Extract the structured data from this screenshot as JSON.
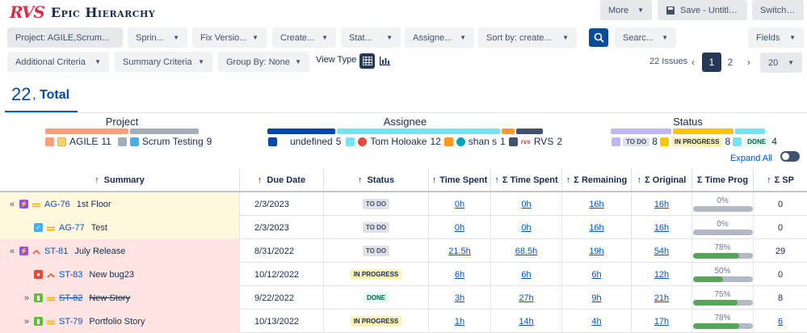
{
  "app": {
    "logo": "RVS",
    "title": "Epic Hierarchy"
  },
  "top_buttons": {
    "more": "More",
    "save": "Save - Untitled...",
    "switch": "Switch to"
  },
  "filters": {
    "project": "Project: AGILE,Scrum...",
    "sprint": "Sprin...",
    "fix_version": "Fix Versio...",
    "created": "Create...",
    "status": "Stat...",
    "assignee": "Assigne...",
    "sort": "Sort by: create...",
    "search": "Searc...",
    "fields": "Fields",
    "additional": "Additional Criteria",
    "summary": "Summary Criteria",
    "group_by": "Group By: None"
  },
  "view_type_label": "View Type",
  "pagination": {
    "issues": "22 Issues",
    "pages": [
      "1",
      "2"
    ],
    "current": "1",
    "page_size": "20"
  },
  "total": {
    "count": "22",
    "label": "Total"
  },
  "groups": {
    "project": {
      "title": "Project",
      "items": [
        {
          "name": "AGILE",
          "count": "11",
          "color": "#f79e7a"
        },
        {
          "name": "Scrum Testing",
          "count": "9",
          "color": "#a5adba"
        }
      ]
    },
    "assignee": {
      "title": "Assignee",
      "items": [
        {
          "name": "undefined",
          "count": "5",
          "color": "#0747a6"
        },
        {
          "name": "Tom Holoake",
          "count": "12",
          "color": "#79e2f2"
        },
        {
          "name": "shan s",
          "count": "1",
          "color": "#ff991f"
        },
        {
          "name": "RVS",
          "count": "2",
          "color": "#42526e"
        }
      ]
    },
    "status": {
      "title": "Status",
      "items": [
        {
          "name": "TO DO",
          "count": "8",
          "color": "#c0b6f2"
        },
        {
          "name": "IN PROGRESS",
          "count": "8",
          "color": "#ffc400"
        },
        {
          "name": "DONE",
          "count": "4",
          "color": "#79e2f2"
        }
      ]
    }
  },
  "expand_all": "Expand All",
  "columns": {
    "summary": "Summary",
    "due": "Due Date",
    "status": "Status",
    "time_spent": "Time Spent",
    "sum_time_spent": "Σ Time Spent",
    "remaining": "Σ Remaining",
    "original": "Σ Original",
    "time_prog": "Σ Time Prog",
    "sp": "Σ SP"
  },
  "rows": [
    {
      "expand": "«",
      "type": "epic",
      "priority": "medium",
      "key": "AG-76",
      "summary": "1st Floor",
      "due": "2/3/2023",
      "status": "TO DO",
      "time_spent": "0h",
      "sum_time_spent": "0h",
      "remaining": "16h",
      "original": "16h",
      "prog_pct": "0%",
      "prog": 0,
      "sp": "0",
      "sp_link": false,
      "bg": "#fff8dc",
      "strike": false
    },
    {
      "expand": "",
      "type": "task",
      "priority": "medium",
      "key": "AG-77",
      "summary": "Test",
      "due": "2/3/2023",
      "status": "TO DO",
      "time_spent": "0h",
      "sum_time_spent": "0h",
      "remaining": "16h",
      "original": "16h",
      "prog_pct": "0%",
      "prog": 0,
      "sp": "0",
      "sp_link": false,
      "bg": "#fff8dc",
      "strike": false
    },
    {
      "expand": "«",
      "type": "epic",
      "priority": "high",
      "key": "ST-81",
      "summary": "July Release",
      "due": "8/31/2022",
      "status": "TO DO",
      "time_spent": "21.5h",
      "sum_time_spent": "68.5h",
      "remaining": "19h",
      "original": "54h",
      "prog_pct": "78%",
      "prog": 78,
      "sp": "29",
      "sp_link": false,
      "bg": "#ffe4e1",
      "strike": false
    },
    {
      "expand": "",
      "type": "bug",
      "priority": "high",
      "key": "ST-83",
      "summary": "New bug23",
      "due": "10/12/2022",
      "status": "IN PROGRESS",
      "time_spent": "6h",
      "sum_time_spent": "6h",
      "remaining": "6h",
      "original": "12h",
      "prog_pct": "50%",
      "prog": 50,
      "sp": "0",
      "sp_link": false,
      "bg": "#ffe4e1",
      "strike": false
    },
    {
      "expand": "»",
      "type": "story",
      "priority": "medium",
      "key": "ST-82",
      "summary": "New Story",
      "due": "9/22/2022",
      "status": "DONE",
      "time_spent": "3h",
      "sum_time_spent": "27h",
      "remaining": "9h",
      "original": "21h",
      "prog_pct": "75%",
      "prog": 75,
      "sp": "8",
      "sp_link": false,
      "bg": "#ffe4e1",
      "strike": true
    },
    {
      "expand": "»",
      "type": "story",
      "priority": "medium",
      "key": "ST-79",
      "summary": "Portfolio Story",
      "due": "10/13/2022",
      "status": "IN PROGRESS",
      "time_spent": "1h",
      "sum_time_spent": "14h",
      "remaining": "4h",
      "original": "17h",
      "prog_pct": "78%",
      "prog": 78,
      "sp": "6",
      "sp_link": true,
      "bg": "#ffe4e1",
      "strike": false
    }
  ],
  "colors": {
    "accent": "#0052cc",
    "todo_bg": "#dfe1e6",
    "todo_fg": "#42526e",
    "inprog_bg": "#fff0b3",
    "inprog_fg": "#172b4d",
    "done_bg": "#e3fcef",
    "done_fg": "#006644",
    "epic": "#904ee2",
    "task": "#4bade8",
    "bug": "#e5493a",
    "story": "#63ba3c",
    "prio_medium": "#ffab00",
    "prio_high": "#ff5630"
  }
}
